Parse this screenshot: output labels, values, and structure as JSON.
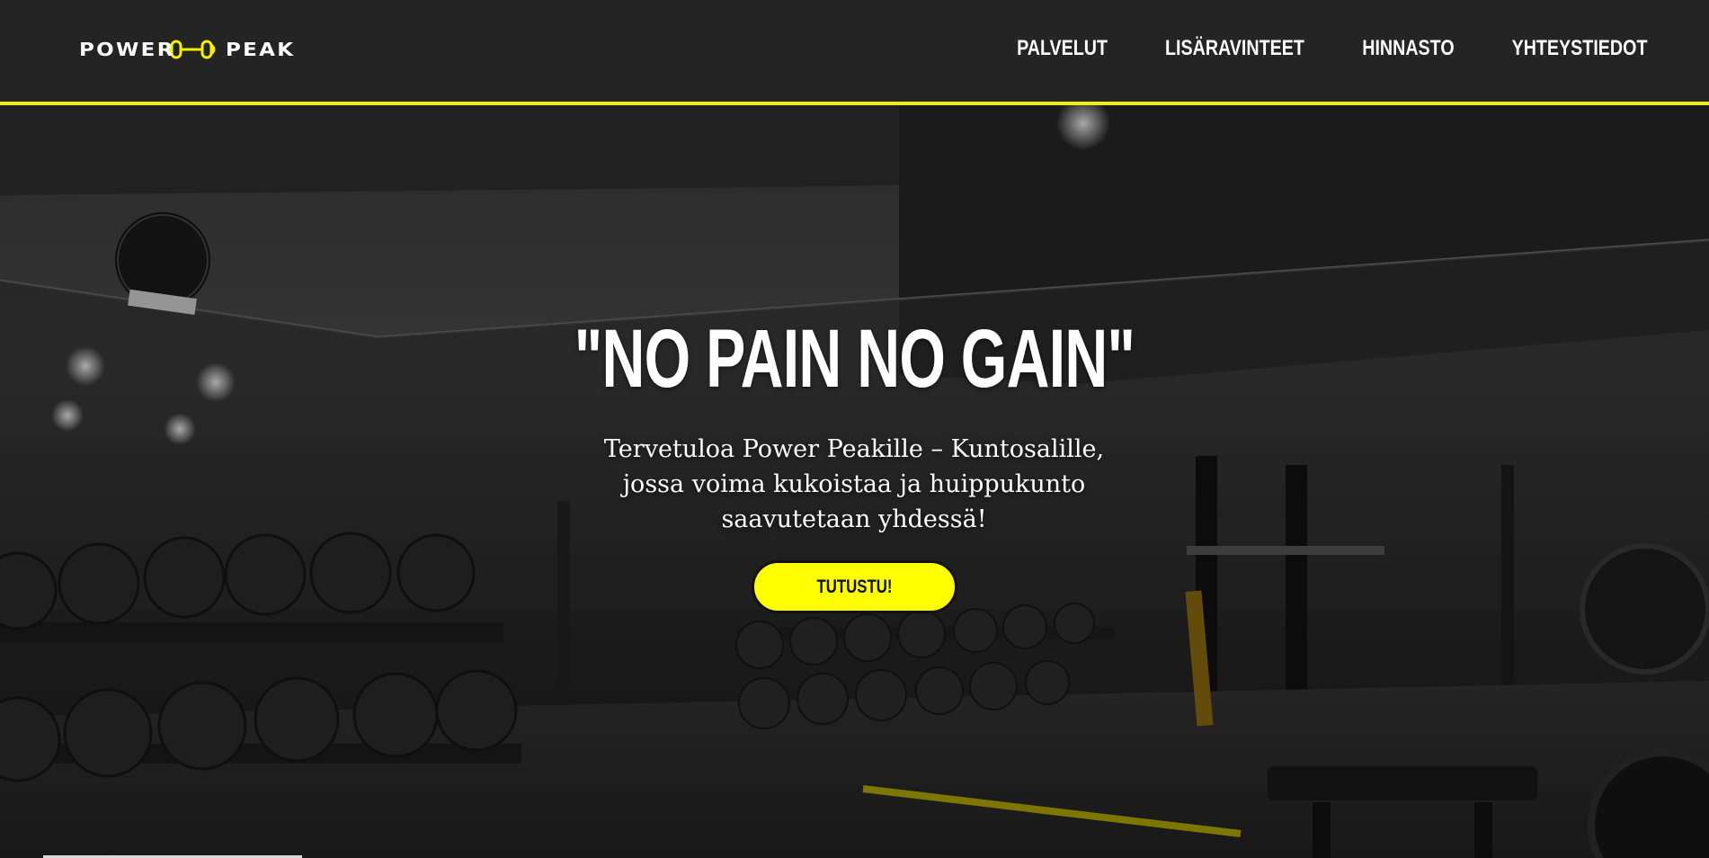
{
  "header": {
    "logo_word_1": "POWER",
    "logo_word_2": "PEAK",
    "logo_icon": "dumbbell-icon",
    "accent_color": "#f5f000",
    "nav": [
      {
        "label": "PALVELUT"
      },
      {
        "label": "LISÄRAVINTEET"
      },
      {
        "label": "HINNASTO"
      },
      {
        "label": "YHTEYSTIEDOT"
      }
    ]
  },
  "hero": {
    "title": "\"NO PAIN NO GAIN\"",
    "subtitle": "Tervetuloa Power Peakille – Kuntosalille, jossa voima kukoistaa ja huippukunto saavutetaan yhdessä!",
    "cta_label": "TUTUSTU!",
    "cta_color": "#ffff00",
    "background": "gym-interior-photo"
  }
}
